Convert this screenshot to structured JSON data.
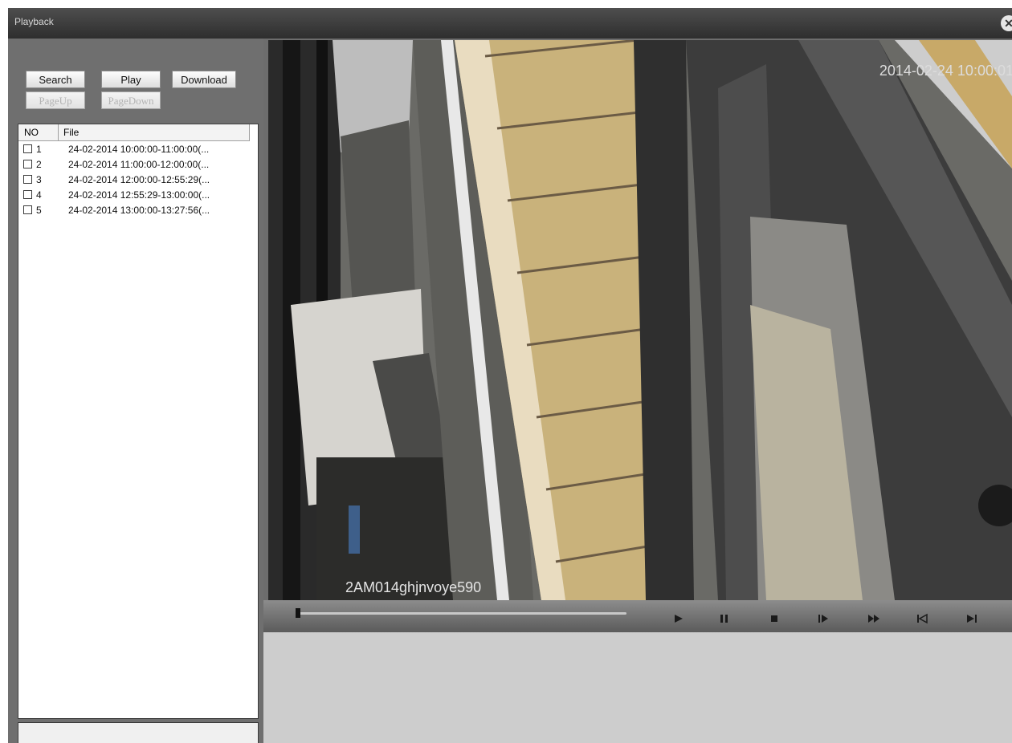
{
  "window": {
    "title": "Playback",
    "close_glyph": "✕"
  },
  "buttons": {
    "search": "Search",
    "play": "Play",
    "download": "Download",
    "pageup": "PageUp",
    "pagedown": "PageDown"
  },
  "list": {
    "headers": {
      "no": "NO",
      "file": "File"
    },
    "rows": [
      {
        "no": "1",
        "file": "24-02-2014 10:00:00-11:00:00(..."
      },
      {
        "no": "2",
        "file": "24-02-2014 11:00:00-12:00:00(..."
      },
      {
        "no": "3",
        "file": "24-02-2014 12:00:00-12:55:29(..."
      },
      {
        "no": "4",
        "file": "24-02-2014 12:55:29-13:00:00(..."
      },
      {
        "no": "5",
        "file": "24-02-2014 13:00:00-13:27:56(..."
      }
    ]
  },
  "video": {
    "timestamp": "2014-02-24 10:00:01",
    "camera_name": "2AM014ghjnvoye590"
  },
  "playback": {
    "progress": 0.0,
    "controls": [
      "play-icon",
      "pause-icon",
      "stop-icon",
      "step-forward-icon",
      "fast-forward-icon",
      "previous-file-icon",
      "next-file-icon"
    ]
  }
}
